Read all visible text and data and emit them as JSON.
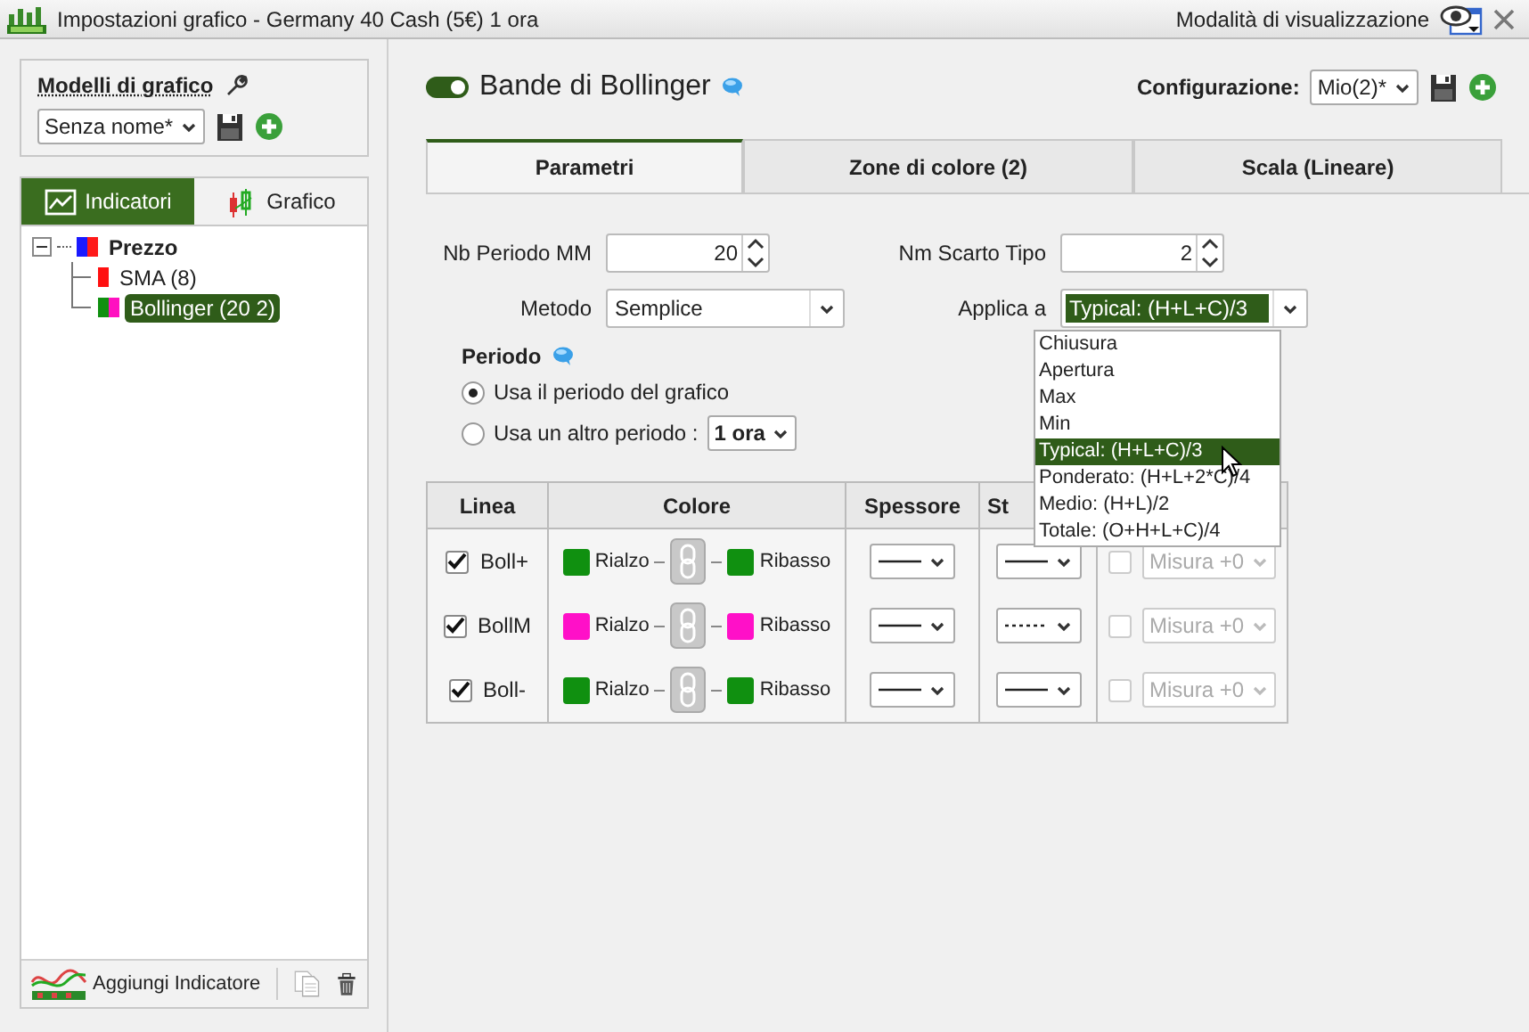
{
  "window": {
    "title": "Impostazioni grafico - Germany 40 Cash (5€) 1 ora",
    "view_mode": "Modalità di visualizzazione"
  },
  "models": {
    "title": "Modelli di grafico",
    "value": "Senza nome*"
  },
  "left_tabs": [
    {
      "label": "Indicatori",
      "selected": true
    },
    {
      "label": "Grafico",
      "selected": false
    }
  ],
  "tree": [
    {
      "label": "Prezzo",
      "kind": "price",
      "expanded": true,
      "selected": false,
      "children": [
        {
          "label": "SMA (8)",
          "kind": "average",
          "selected": false
        },
        {
          "label": "Bollinger (20 2)",
          "kind": "bands",
          "selected": true
        }
      ]
    }
  ],
  "add_indicator": "Aggiungi Indicatore",
  "indicator": {
    "title": "Bande di Bollinger",
    "enabled": true
  },
  "configuration": {
    "label": "Configurazione:",
    "value": "Mio(2)*"
  },
  "tabs": [
    {
      "label": "Parametri",
      "selected": true
    },
    {
      "label": "Zone di colore (2)",
      "selected": false
    },
    {
      "label": "Scala (Lineare)",
      "selected": false
    }
  ],
  "fields": [
    {
      "label": "Nb Periodo MM",
      "kind": "spin",
      "value": "20"
    },
    {
      "label": "Nm Scarto Tipo",
      "kind": "spin",
      "value": "2"
    },
    {
      "label": "Metodo",
      "kind": "select",
      "value": "Semplice"
    },
    {
      "label": "Applica a",
      "kind": "select",
      "value": "Typical: (H+L+C)/3",
      "open": true
    }
  ],
  "period": {
    "title": "Periodo",
    "options": [
      {
        "label": "Usa il periodo del grafico",
        "selected": true
      },
      {
        "label": "Usa un altro periodo :",
        "selected": false,
        "value": "1 ora"
      }
    ]
  },
  "table": {
    "columns": [
      "Linea",
      "Colore",
      "Spessore",
      "St"
    ],
    "rows": [
      {
        "label": "Boll+",
        "checked": true,
        "swatches": [
          {
            "label": "Rialzo",
            "color": "#109010"
          },
          {
            "label": "Ribasso",
            "color": "#109010"
          }
        ],
        "kind": "solid",
        "offset_checked": false,
        "offset": "Misura +0",
        "offset_disabled": true
      },
      {
        "label": "BollM",
        "checked": true,
        "swatches": [
          {
            "label": "Rialzo",
            "color": "#ff10c8"
          },
          {
            "label": "Ribasso",
            "color": "#ff10c8"
          }
        ],
        "kind": "dotted",
        "offset_checked": false,
        "offset": "Misura +0",
        "offset_disabled": true
      },
      {
        "label": "Boll-",
        "checked": true,
        "swatches": [
          {
            "label": "Rialzo",
            "color": "#109010"
          },
          {
            "label": "Ribasso",
            "color": "#109010"
          }
        ],
        "kind": "solid",
        "offset_checked": false,
        "offset": "Misura +0",
        "offset_disabled": true
      }
    ]
  },
  "dropdown": [
    {
      "label": "Chiusura",
      "selected": false
    },
    {
      "label": "Apertura",
      "selected": false
    },
    {
      "label": "Max",
      "selected": false
    },
    {
      "label": "Min",
      "selected": false
    },
    {
      "label": "Typical: (H+L+C)/3",
      "selected": true
    },
    {
      "label": "Ponderato: (H+L+2*C)/4",
      "selected": false
    },
    {
      "label": "Medio: (H+L)/2",
      "selected": false
    },
    {
      "label": "Totale: (O+H+L+C)/4",
      "selected": false
    }
  ]
}
